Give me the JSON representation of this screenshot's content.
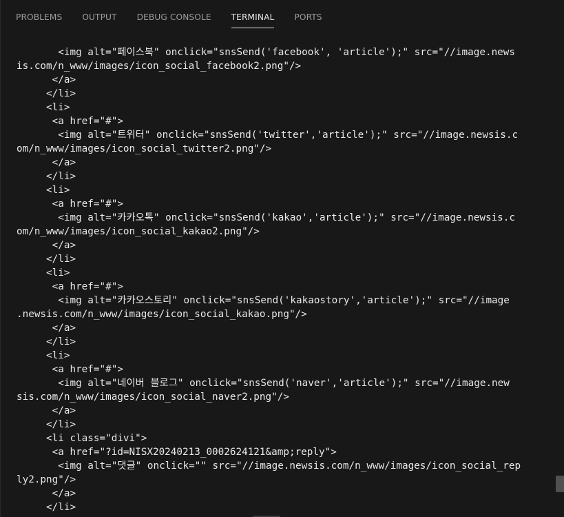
{
  "tabs": [
    "PROBLEMS",
    "OUTPUT",
    "DEBUG CONSOLE",
    "TERMINAL",
    "PORTS"
  ],
  "active_tab": "TERMINAL",
  "terminal_lines": [
    "       <img alt=\"페이스북\" onclick=\"snsSend('facebook', 'article');\" src=\"//image.news",
    "is.com/n_www/images/icon_social_facebook2.png\"/>",
    "      </a>",
    "     </li>",
    "     <li>",
    "      <a href=\"#\">",
    "       <img alt=\"트위터\" onclick=\"snsSend('twitter','article');\" src=\"//image.newsis.c",
    "om/n_www/images/icon_social_twitter2.png\"/>",
    "      </a>",
    "     </li>",
    "     <li>",
    "      <a href=\"#\">",
    "       <img alt=\"카카오톡\" onclick=\"snsSend('kakao','article');\" src=\"//image.newsis.c",
    "om/n_www/images/icon_social_kakao2.png\"/>",
    "      </a>",
    "     </li>",
    "     <li>",
    "      <a href=\"#\">",
    "       <img alt=\"카카오스토리\" onclick=\"snsSend('kakaostory','article');\" src=\"//image",
    ".newsis.com/n_www/images/icon_social_kakao.png\"/>",
    "      </a>",
    "     </li>",
    "     <li>",
    "      <a href=\"#\">",
    "       <img alt=\"네이버 블로그\" onclick=\"snsSend('naver','article');\" src=\"//image.new",
    "sis.com/n_www/images/icon_social_naver2.png\"/>",
    "      </a>",
    "     </li>",
    "     <li class=\"divi\">",
    "      <a href=\"?id=NISX20240213_0002624121&amp;reply\">",
    "       <img alt=\"댓글\" onclick=\"\" src=\"//image.newsis.com/n_www/images/icon_social_rep",
    "ly2.png\"/>",
    "      </a>",
    "     </li>"
  ]
}
